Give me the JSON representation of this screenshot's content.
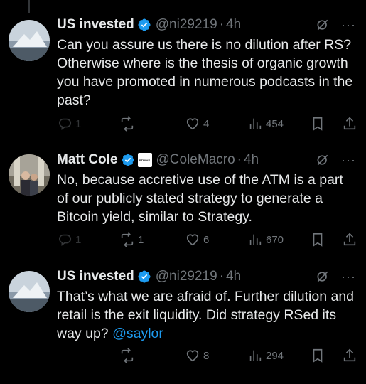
{
  "tweets": [
    {
      "name": "US invested",
      "handle": "@ni29219",
      "dot": "·",
      "time": "4h",
      "text_parts": [
        "Can you assure us there is no dilution after RS? Otherwise where is the thesis of organic growth you have promoted in numerous podcasts in the past?"
      ],
      "mention": "",
      "reply_count": "1",
      "retweet_count": "",
      "like_count": "4",
      "view_count": "454"
    },
    {
      "name": "Matt Cole",
      "handle": "@ColeMacro",
      "dot": "·",
      "time": "4h",
      "org_badge": "STRIVE",
      "text_parts": [
        "No, because accretive use of the ATM is a part of our publicly stated strategy to generate a Bitcoin yield, similar to Strategy."
      ],
      "mention": "",
      "reply_count": "1",
      "retweet_count": "1",
      "like_count": "6",
      "view_count": "670"
    },
    {
      "name": "US invested",
      "handle": "@ni29219",
      "dot": "·",
      "time": "4h",
      "text_parts": [
        "That’s what we are afraid of. Further dilution and retail is the exit liquidity. Did strategy RSed its way up? "
      ],
      "mention": "@saylor",
      "reply_count": "",
      "retweet_count": "",
      "like_count": "8",
      "view_count": "294"
    }
  ],
  "icons": {
    "verified": "verified-badge-icon",
    "grok": "grok-icon",
    "more": "more-icon",
    "reply": "reply-icon",
    "retweet": "retweet-icon",
    "like": "heart-icon",
    "views": "views-icon",
    "bookmark": "bookmark-icon",
    "share": "share-icon"
  },
  "colors": {
    "background": "#000000",
    "text": "#e7e9ea",
    "muted": "#71767b",
    "accent": "#1d9bf0"
  },
  "more_label": "···"
}
